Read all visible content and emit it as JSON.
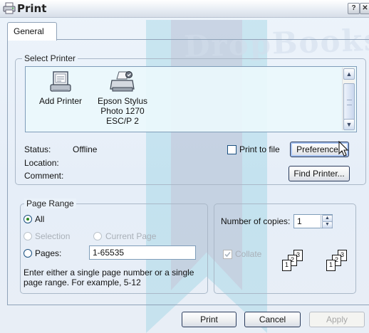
{
  "window": {
    "title": "Print",
    "help_label": "?",
    "close_label": "✕",
    "icon": "printer-icon"
  },
  "watermark": {
    "text": "DropBooks"
  },
  "tabs": [
    {
      "label": "General"
    }
  ],
  "select_printer": {
    "group_label": "Select Printer",
    "printers": [
      {
        "label": "Add Printer",
        "icon": "add-printer-icon"
      },
      {
        "label_lines": [
          "Epson Stylus",
          "Photo 1270",
          "ESC/P 2"
        ],
        "icon": "printer-icon"
      }
    ],
    "status_label": "Status:",
    "status_value": "Offline",
    "location_label": "Location:",
    "comment_label": "Comment:",
    "print_to_file_label": "Print to file",
    "print_to_file_checked": false,
    "preferences_label": "Preferences",
    "find_printer_label": "Find Printer..."
  },
  "page_range": {
    "group_label": "Page Range",
    "all_label": "All",
    "selection_label": "Selection",
    "current_page_label": "Current Page",
    "pages_label": "Pages:",
    "pages_value": "1-65535",
    "selected": "All",
    "help_lines": [
      "Enter either a single page number or a single",
      "page range.  For example, 5-12"
    ]
  },
  "copies": {
    "label": "Number of copies:",
    "value": "1",
    "collate_label": "Collate",
    "collate_checked": true,
    "collate_pages": [
      "1",
      "2",
      "3"
    ]
  },
  "footer": {
    "print_label": "Print",
    "cancel_label": "Cancel",
    "apply_label": "Apply"
  }
}
